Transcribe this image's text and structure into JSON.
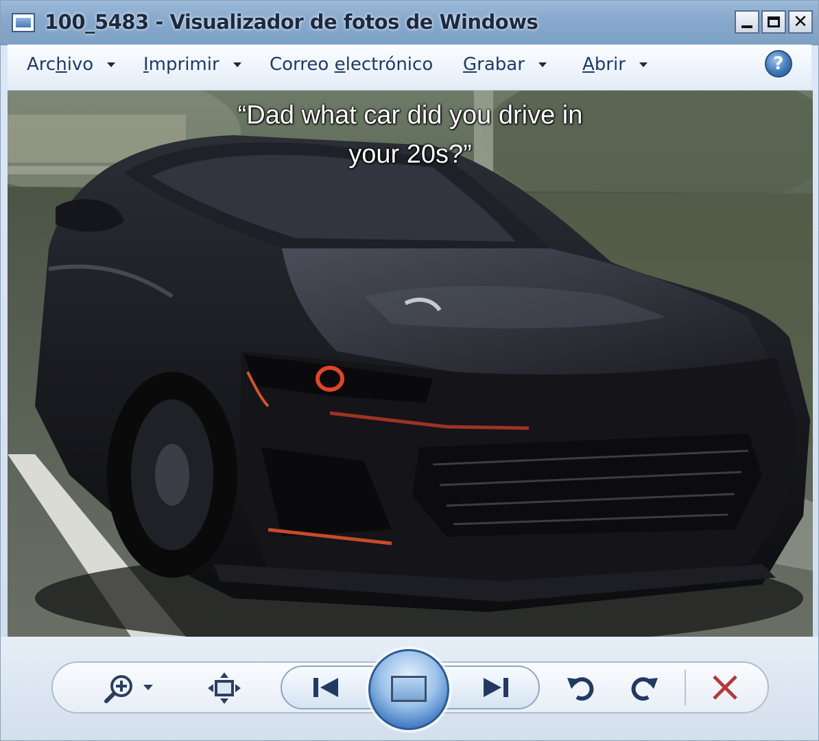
{
  "window": {
    "title": "100_5483 - Visualizador de fotos de Windows",
    "icon": "photo-viewer-app-icon",
    "controls": {
      "minimize_icon": "minimize-icon",
      "maximize_icon": "maximize-icon",
      "close_glyph": "✕"
    }
  },
  "menubar": {
    "items": [
      {
        "pre": "Arc",
        "u": "h",
        "post": "ivo",
        "has_dropdown": true
      },
      {
        "pre": "",
        "u": "I",
        "post": "mprimir",
        "has_dropdown": true
      },
      {
        "pre": "Correo ",
        "u": "e",
        "post": "lectrónico",
        "has_dropdown": false
      },
      {
        "pre": "",
        "u": "G",
        "post": "rabar",
        "has_dropdown": true
      },
      {
        "pre": "",
        "u": "A",
        "post": "brir",
        "has_dropdown": true
      }
    ],
    "help_glyph": "?"
  },
  "photo": {
    "caption_line1": "“Dad what car did you drive in",
    "caption_line2": "your 20s?”",
    "subject": "black sports car"
  },
  "toolbar": {
    "icons": [
      "zoom-icon",
      "fit-to-window-icon",
      "previous-icon",
      "slideshow-icon",
      "next-icon",
      "rotate-counterclockwise-icon",
      "rotate-clockwise-icon",
      "delete-icon"
    ]
  },
  "colors": {
    "titlebar": "#86a8cc",
    "menu_text": "#1f3a66",
    "accent_blue": "#3e78c0",
    "delete_red": "#b23b3b"
  }
}
